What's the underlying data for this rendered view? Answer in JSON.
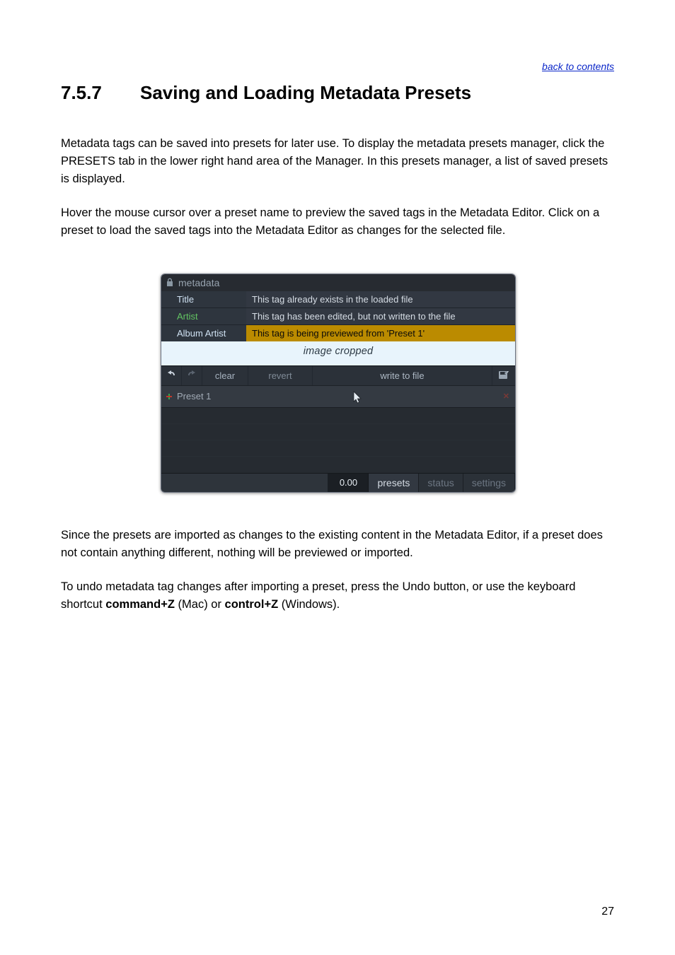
{
  "nav": {
    "back_link": "back to contents"
  },
  "heading": {
    "number": "7.5.7",
    "title": "Saving and Loading Metadata Presets"
  },
  "paragraphs": {
    "p1": "Metadata tags can be saved into presets for later use. To display the metadata presets manager, click the PRESETS tab in the lower right hand area of the Manager. In this presets manager, a list of saved presets is displayed.",
    "p2": "Hover the mouse cursor over a preset name to preview the saved tags in the Metadata Editor. Click on a preset to load the saved tags into the Metadata Editor as changes for the selected file.",
    "p3": "Since the presets are imported as changes to the existing content in the Metadata Editor, if a preset does not contain anything different, nothing will be previewed or imported.",
    "p4_a": "To undo metadata tag changes after importing a preset, press the Undo button, or use the keyboard shortcut ",
    "p4_mac": "command+Z",
    "p4_b": " (Mac) or ",
    "p4_win": "control+Z",
    "p4_c": " (Windows)."
  },
  "screenshot": {
    "window_title": "metadata",
    "rows": {
      "title_label": "Title",
      "title_value": "This tag already exists in the loaded file",
      "artist_label": "Artist",
      "artist_value": "This tag has been edited, but not written to the file",
      "album_artist_label": "Album Artist",
      "album_artist_value": "This tag is being previewed from 'Preset 1'"
    },
    "cropped_label": "image cropped",
    "toolbar": {
      "clear": "clear",
      "revert": "revert",
      "write": "write to file"
    },
    "preset_row": {
      "name": "Preset 1"
    },
    "bottom": {
      "time": "0.00",
      "tabs": {
        "presets": "presets",
        "status": "status",
        "settings": "settings"
      }
    }
  },
  "page_number": "27"
}
